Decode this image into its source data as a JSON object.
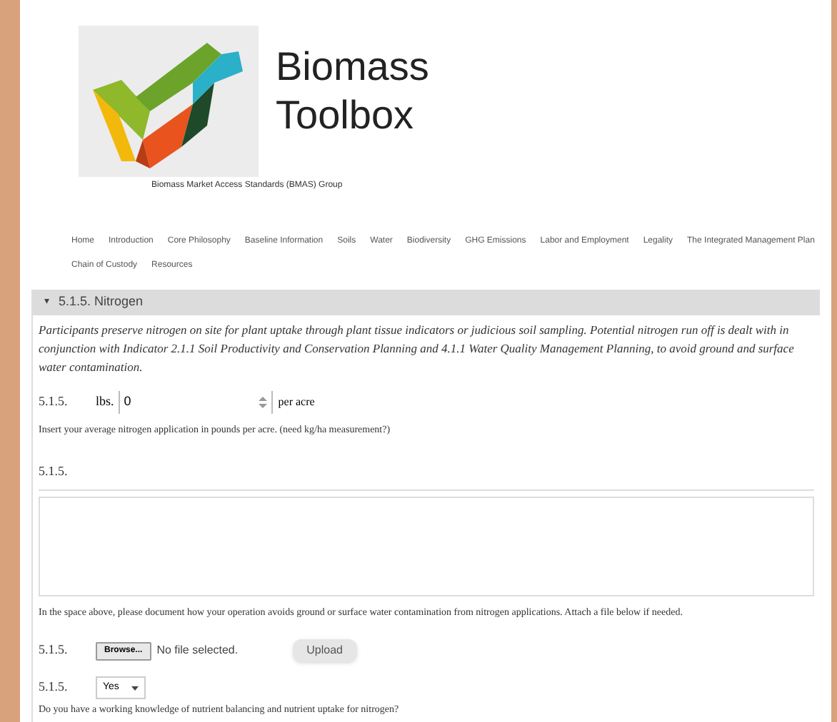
{
  "header": {
    "title_line1": "Biomass",
    "title_line2": "Toolbox",
    "subtitle": "Biomass Market Access Standards (BMAS) Group"
  },
  "nav": {
    "items": [
      "Home",
      "Introduction",
      "Core Philosophy",
      "Baseline Information",
      "Soils",
      "Water",
      "Biodiversity",
      "GHG Emissions",
      "Labor and Employment",
      "Legality",
      "The Integrated Management Plan",
      "Chain of Custody",
      "Resources"
    ]
  },
  "section": {
    "toggle": "▾",
    "title": "5.1.5. Nitrogen",
    "expanded": true,
    "description": "Participants preserve nitrogen on site for plant uptake through plant tissue indicators or judicious soil sampling. Potential nitrogen run off is dealt with in conjunction with Indicator 2.1.1 Soil Productivity and Conservation Planning and 4.1.1 Water Quality Management Planning, to avoid ground and surface water contamination.",
    "fields": [
      {
        "kind": "number",
        "number": "5.1.5.",
        "prefix": "lbs.",
        "value": "0",
        "suffix": "per acre",
        "help": "Insert your average nitrogen application in pounds per acre. (need kg/ha measurement?)"
      },
      {
        "kind": "textarea",
        "number": "5.1.5.",
        "help": "In the space above, please document how your operation avoids ground or surface water contamination from nitrogen applications. Attach a file below if needed."
      },
      {
        "kind": "file",
        "number": "5.1.5.",
        "browse": "Browse...",
        "status": "No file selected.",
        "upload": "Upload"
      },
      {
        "kind": "select",
        "number": "5.1.5.",
        "value": "Yes",
        "help": "Do you have a working knowledge of nutrient balancing and nutrient uptake for nitrogen?"
      }
    ]
  }
}
